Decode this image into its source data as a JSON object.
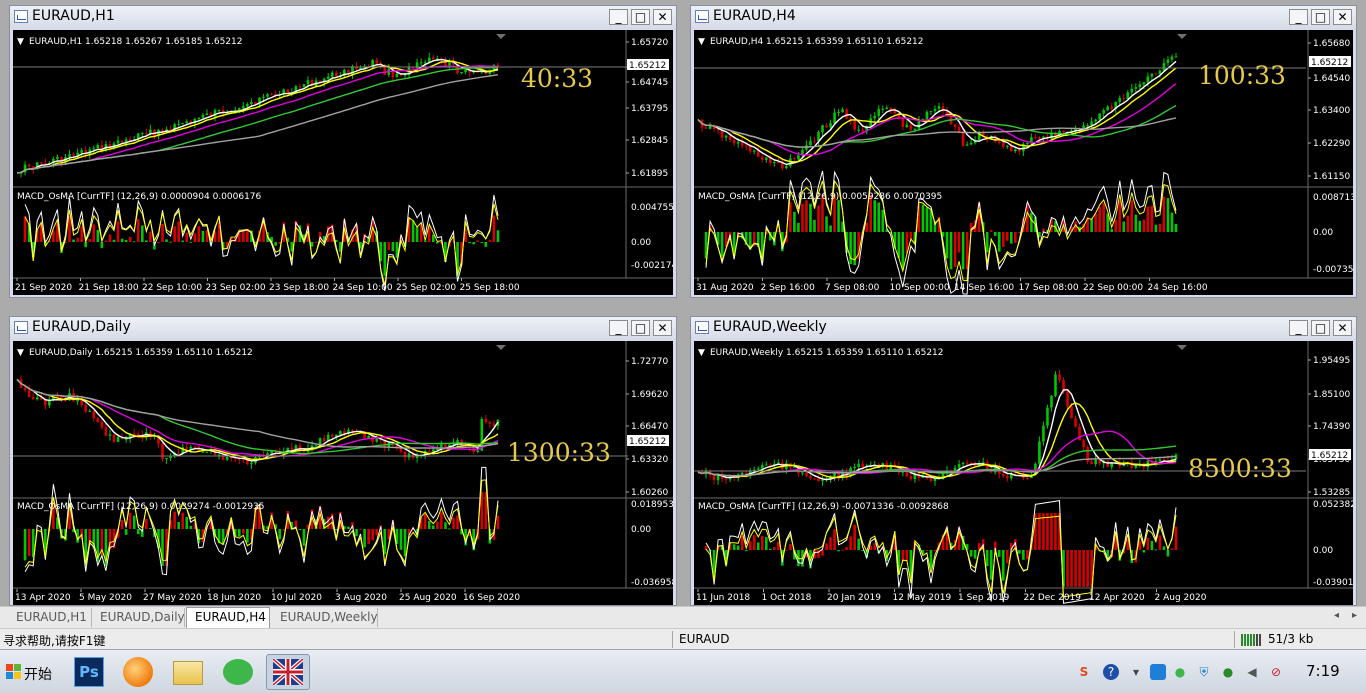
{
  "windows": [
    {
      "title": "EURAUD,H1",
      "header": "EURAUD,H1  1.65218 1.65267 1.65185 1.65212",
      "price_labels": [
        "1.65720",
        "1.64745",
        "1.63795",
        "1.62845",
        "1.61895"
      ],
      "current_price": "1.65212",
      "big_number": "40:33",
      "macd_header": "MACD_OsMA [CurrTF] (12,26,9) 0.0000904 0.0006176",
      "macd_labels": [
        "0.0047551",
        "0.00",
        "-0.002174"
      ],
      "time_labels": [
        "21 Sep 2020",
        "21 Sep 18:00",
        "22 Sep 10:00",
        "23 Sep 02:00",
        "23 Sep 18:00",
        "24 Sep 10:00",
        "25 Sep 02:00",
        "25 Sep 18:00"
      ]
    },
    {
      "title": "EURAUD,H4",
      "header": "EURAUD,H4  1.65215 1.65359 1.65110 1.65212",
      "price_labels": [
        "1.65680",
        "1.64540",
        "1.63400",
        "1.62290",
        "1.61150"
      ],
      "current_price": "1.65212",
      "big_number": "100:33",
      "macd_header": "MACD_OsMA [CurrTF] (12,26,9) 0.0059286 0.0070395",
      "macd_labels": [
        "0.0087135",
        "0.00",
        "-0.007358"
      ],
      "time_labels": [
        "31 Aug 2020",
        "2 Sep 16:00",
        "7 Sep 08:00",
        "10 Sep 00:00",
        "14 Sep 16:00",
        "17 Sep 08:00",
        "22 Sep 00:00",
        "24 Sep 16:00"
      ]
    },
    {
      "title": "EURAUD,Daily",
      "header": "EURAUD,Daily  1.65215 1.65359 1.65110 1.65212",
      "price_labels": [
        "1.72770",
        "1.69620",
        "1.66470",
        "1.63320",
        "1.60260"
      ],
      "current_price": "1.65212",
      "big_number": "1300:33",
      "macd_header": "MACD_OsMA [CurrTF] (12,26,9) 0.0039274 -0.0012935",
      "macd_labels": [
        "0.0189537",
        "0.00",
        "-0.036958"
      ],
      "time_labels": [
        "13 Apr 2020",
        "5 May 2020",
        "27 May 2020",
        "18 Jun 2020",
        "10 Jul 2020",
        "3 Aug 2020",
        "25 Aug 2020",
        "16 Sep 2020"
      ]
    },
    {
      "title": "EURAUD,Weekly",
      "header": "EURAUD,Weekly  1.65215 1.65359 1.65110 1.65212",
      "price_labels": [
        "1.95495",
        "1.85100",
        "1.74390",
        "1.63730",
        "1.53285"
      ],
      "current_price": "1.65212",
      "big_number": "8500:33",
      "macd_header": "MACD_OsMA [CurrTF] (12,26,9) -0.0071336 -0.0092868",
      "macd_labels": [
        "0.0523829",
        "0.00",
        "-0.039012"
      ],
      "time_labels": [
        "11 Jun 2018",
        "1 Oct 2018",
        "20 Jan 2019",
        "12 May 2019",
        "1 Sep 2019",
        "22 Dec 2019",
        "12 Apr 2020",
        "2 Aug 2020"
      ]
    }
  ],
  "window_buttons": {
    "minimize": "_",
    "maximize": "□",
    "close": "✕"
  },
  "tabs": [
    {
      "label": "EURAUD,H1",
      "active": false
    },
    {
      "label": "EURAUD,Daily",
      "active": false
    },
    {
      "label": "EURAUD,H4",
      "active": true
    },
    {
      "label": "EURAUD,Weekly",
      "active": false
    }
  ],
  "status": {
    "help": "寻求帮助,请按F1键",
    "symbol": "EURAUD",
    "traffic": "51/3 kb"
  },
  "taskbar": {
    "start_label": "开始",
    "apps": [
      {
        "icon": "photoshop-icon",
        "label": "Ps"
      },
      {
        "icon": "media-player-icon"
      },
      {
        "icon": "folder-icon"
      },
      {
        "icon": "wechat-icon"
      },
      {
        "icon": "metatrader-icon"
      }
    ],
    "clock": "7:19"
  },
  "colors": {
    "bull": "#00c800",
    "bear": "#d90000",
    "ma_fast": "#ffff00",
    "ma_white": "#ffffff",
    "ma_magenta": "#e000e0",
    "ma_green": "#32c832",
    "ma_gray": "#a0a0a0",
    "big_number": "#e6c94a"
  }
}
